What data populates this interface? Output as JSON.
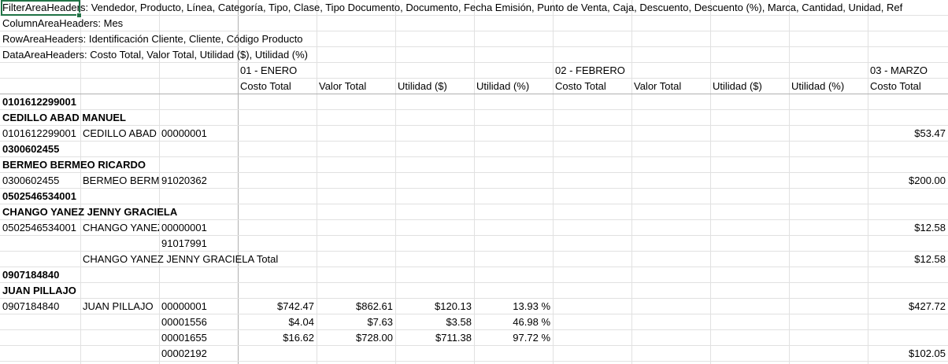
{
  "meta_rows": [
    "FilterAreaHeaders: Vendedor, Producto, Línea, Categoría, Tipo, Clase, Tipo Documento, Documento, Fecha Emisión, Punto de Venta, Caja, Descuento, Descuento (%), Marca, Cantidad, Unidad, Ref",
    "ColumnAreaHeaders: Mes",
    "RowAreaHeaders: Identificación Cliente, Cliente, Código Producto",
    "DataAreaHeaders: Costo Total, Valor Total, Utilidad ($), Utilidad (%)"
  ],
  "months": [
    "01 - ENERO",
    "02 - FEBRERO",
    "03 - MARZO"
  ],
  "measures": [
    "Costo Total",
    "Valor Total",
    "Utilidad ($)",
    "Utilidad (%)",
    "Costo Total",
    "Valor Total",
    "Utilidad ($)",
    "Utilidad (%)",
    "Costo Total"
  ],
  "rows": [
    {
      "type": "group",
      "a": "0101612299001"
    },
    {
      "type": "group",
      "a": "CEDILLO ABAD MANUEL"
    },
    {
      "type": "data",
      "a": "0101612299001",
      "b": "CEDILLO ABAD MANUEL",
      "c": "00000001",
      "v": [
        "",
        "",
        "",
        "",
        "",
        "",
        "",
        "",
        ""
      ],
      "last": "$53.47"
    },
    {
      "type": "group",
      "a": "0300602455"
    },
    {
      "type": "group",
      "a": "BERMEO BERMEO RICARDO"
    },
    {
      "type": "data",
      "a": "0300602455",
      "b": "BERMEO BERMEO RICARDO",
      "c": "91020362",
      "v": [
        "",
        "",
        "",
        ""
      ],
      "last": "$200.00"
    },
    {
      "type": "group",
      "a": "0502546534001"
    },
    {
      "type": "group",
      "a": "CHANGO YANEZ JENNY GRACIELA"
    },
    {
      "type": "data",
      "a": "0502546534001",
      "b": "CHANGO YANEZ JENNY GRACIELA",
      "c": "00000001",
      "v": [
        "",
        "",
        "",
        ""
      ],
      "last": "$12.58"
    },
    {
      "type": "data",
      "a": "",
      "b": "",
      "c": "91017991",
      "v": [
        "",
        "",
        "",
        ""
      ],
      "last": ""
    },
    {
      "type": "total",
      "b": "CHANGO YANEZ JENNY GRACIELA Total",
      "last": "$12.58"
    },
    {
      "type": "group",
      "a": "0907184840"
    },
    {
      "type": "group",
      "a": "JUAN PILLAJO"
    },
    {
      "type": "data",
      "a": "0907184840",
      "b": "JUAN PILLAJO",
      "c": "00000001",
      "v": [
        "$742.47",
        "$862.61",
        "$120.13",
        "13.93 %"
      ],
      "last": "$427.72"
    },
    {
      "type": "data",
      "a": "",
      "b": "",
      "c": "00001556",
      "v": [
        "$4.04",
        "$7.63",
        "$3.58",
        "46.98 %"
      ],
      "last": ""
    },
    {
      "type": "data",
      "a": "",
      "b": "",
      "c": "00001655",
      "v": [
        "$16.62",
        "$728.00",
        "$711.38",
        "97.72 %"
      ],
      "last": ""
    },
    {
      "type": "data",
      "a": "",
      "b": "",
      "c": "00002192",
      "v": [
        "",
        "",
        "",
        ""
      ],
      "last": "$102.05"
    }
  ]
}
